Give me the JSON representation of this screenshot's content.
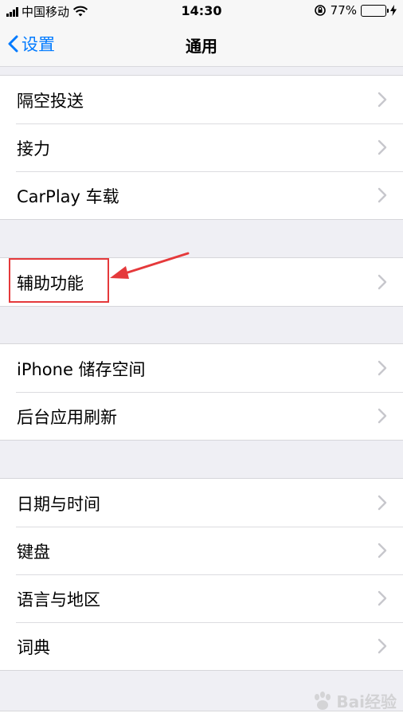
{
  "status_bar": {
    "carrier": "中国移动",
    "time": "14:30",
    "battery_percent": "77%",
    "battery_level": 0.77
  },
  "nav": {
    "back_label": "设置",
    "title": "通用"
  },
  "groups": [
    {
      "items": [
        {
          "label": "隔空投送"
        },
        {
          "label": "接力"
        },
        {
          "label": "CarPlay 车载"
        }
      ]
    },
    {
      "items": [
        {
          "label": "辅助功能"
        }
      ]
    },
    {
      "items": [
        {
          "label": "iPhone 储存空间"
        },
        {
          "label": "后台应用刷新"
        }
      ]
    },
    {
      "items": [
        {
          "label": "日期与时间"
        },
        {
          "label": "键盘"
        },
        {
          "label": "语言与地区"
        },
        {
          "label": "词典"
        }
      ]
    }
  ],
  "annotation": {
    "highlight_color": "#e5393b"
  },
  "watermark": {
    "text": "Bai经验"
  },
  "colors": {
    "accent": "#007aff",
    "battery": "#4cd964",
    "background": "#efeff4"
  }
}
